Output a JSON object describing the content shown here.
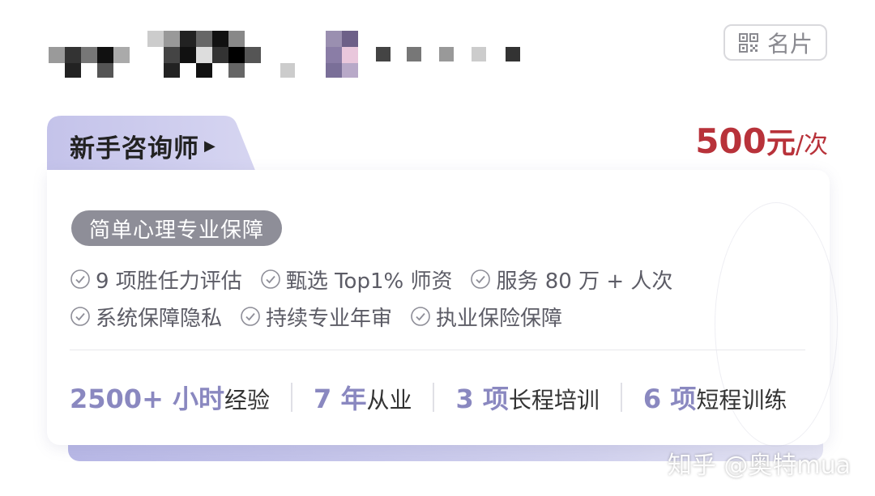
{
  "header": {
    "card_button_label": "名片",
    "card_icon": "qr-card-icon"
  },
  "tab": {
    "level_label": "新手咨询师",
    "arrow_icon": "play-arrow-icon"
  },
  "price": {
    "amount": "500",
    "unit": "元",
    "per": "/次"
  },
  "card": {
    "badge": "简单心理专业保障",
    "features_row1": [
      "9 项胜任力评估",
      "甄选 Top1% 师资",
      "服务 80 万 + 人次"
    ],
    "features_row2": [
      "系统保障隐私",
      "持续专业年审",
      "执业保险保障"
    ],
    "stats": [
      {
        "num": "2500+ 小时",
        "txt": "经验"
      },
      {
        "num": "7 年",
        "txt": "从业"
      },
      {
        "num": "3 项",
        "txt": "长程培训"
      },
      {
        "num": "6 项",
        "txt": "短程训练"
      }
    ]
  },
  "watermark": "知乎 @奥特mua",
  "colors": {
    "price": "#b8323a",
    "stat_number": "#8a88c0",
    "tab_bg": "#c9c8ec",
    "badge_bg": "#8e8e98"
  }
}
